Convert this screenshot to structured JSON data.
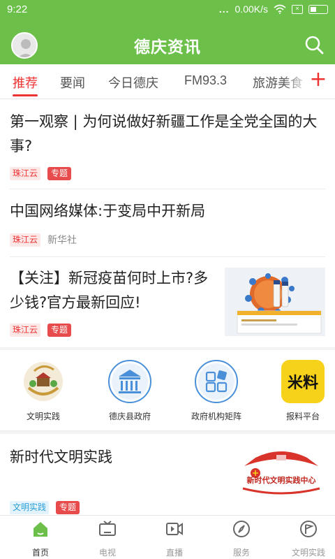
{
  "status_bar": {
    "time": "9:22",
    "dots": "...",
    "speed": "0.00K/s"
  },
  "app_bar": {
    "title": "德庆资讯"
  },
  "tabs": [
    {
      "label": "推荐",
      "active": true
    },
    {
      "label": "要闻",
      "active": false
    },
    {
      "label": "今日德庆",
      "active": false
    },
    {
      "label": "FM93.3",
      "active": false
    },
    {
      "label": "旅游美食",
      "active": false
    }
  ],
  "articles": [
    {
      "title": "第一观察 | 为何说做好新疆工作是全党全国的大事?",
      "source": "珠江云",
      "tag": "专题"
    },
    {
      "title": "中国网络媒体:于变局中开新局",
      "source": "珠江云",
      "publisher": "新华社"
    },
    {
      "title": "【关注】新冠疫苗何时上市?多少钱?官方最新回应!",
      "source": "珠江云",
      "tag": "专题"
    },
    {
      "title": "新时代文明实践",
      "source": "文明实践",
      "tag": "专题",
      "image_text": "新时代文明实践中心"
    }
  ],
  "quick_links": [
    {
      "label": "文明实践",
      "icon": "civilization-practice-icon"
    },
    {
      "label": "德庆县政府",
      "icon": "government-building-icon"
    },
    {
      "label": "政府机构矩阵",
      "icon": "agency-matrix-icon"
    },
    {
      "label": "报料平台",
      "icon": "report-platform-icon",
      "icon_text": "米料"
    }
  ],
  "bottom_nav": [
    {
      "label": "首页",
      "icon": "home-icon",
      "active": true
    },
    {
      "label": "电视",
      "icon": "tv-icon",
      "active": false
    },
    {
      "label": "直播",
      "icon": "live-video-icon",
      "active": false
    },
    {
      "label": "服务",
      "icon": "compass-icon",
      "active": false
    },
    {
      "label": "文明实践",
      "icon": "flag-icon",
      "active": false
    }
  ],
  "colors": {
    "brand_green": "#6cc04a",
    "accent_red": "#e33333",
    "tag_blue": "#2ea0d8",
    "report_yellow": "#f7d21a"
  }
}
